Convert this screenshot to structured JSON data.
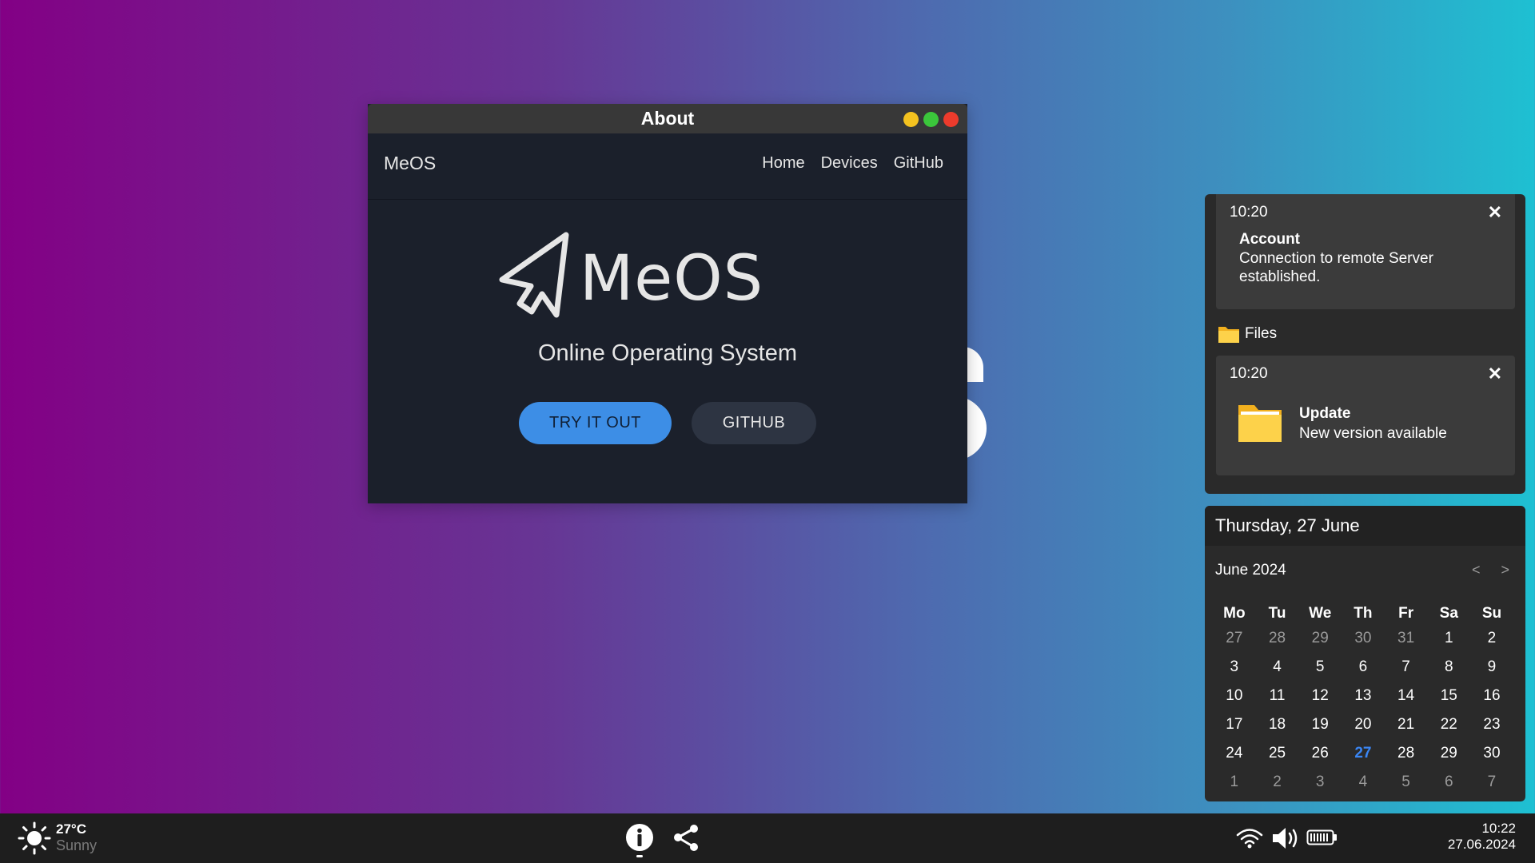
{
  "window": {
    "title": "About",
    "controls": [
      "minimize",
      "maximize",
      "close"
    ]
  },
  "app": {
    "brand": "MeOS",
    "nav": [
      "Home",
      "Devices",
      "GitHub"
    ],
    "logo_text": "MeOS",
    "subtitle": "Online Operating System",
    "primary_button": "TRY IT OUT",
    "secondary_button": "GITHUB"
  },
  "notifications": {
    "items": [
      {
        "time": "10:20",
        "title": "Account",
        "message": "Connection to remote Server established.",
        "close": "✕"
      },
      {
        "time": "10:20",
        "title": "Update",
        "message": "New version available",
        "close": "✕"
      }
    ],
    "group_label": "Files"
  },
  "calendar": {
    "date_header": "Thursday, 27 June",
    "month_label": "June 2024",
    "prev": "<",
    "next": ">",
    "weekdays": [
      "Mo",
      "Tu",
      "We",
      "Th",
      "Fr",
      "Sa",
      "Su"
    ],
    "weeks": [
      [
        "27",
        "28",
        "29",
        "30",
        "31",
        "1",
        "2"
      ],
      [
        "3",
        "4",
        "5",
        "6",
        "7",
        "8",
        "9"
      ],
      [
        "10",
        "11",
        "12",
        "13",
        "14",
        "15",
        "16"
      ],
      [
        "17",
        "18",
        "19",
        "20",
        "21",
        "22",
        "23"
      ],
      [
        "24",
        "25",
        "26",
        "27",
        "28",
        "29",
        "30"
      ],
      [
        "1",
        "2",
        "3",
        "4",
        "5",
        "6",
        "7"
      ]
    ],
    "today": "27"
  },
  "taskbar": {
    "weather": {
      "temp": "27°C",
      "condition": "Sunny",
      "icon": "sun-icon"
    },
    "apps": [
      "info-icon",
      "share-icon"
    ],
    "tray": [
      "wifi-icon",
      "volume-icon",
      "battery-icon"
    ],
    "time": "10:22",
    "date": "27.06.2024"
  },
  "colors": {
    "accent": "#3d8ee6",
    "today": "#3a86f4",
    "window_bg": "#1b202b",
    "panel_bg": "#2a2a2a"
  }
}
